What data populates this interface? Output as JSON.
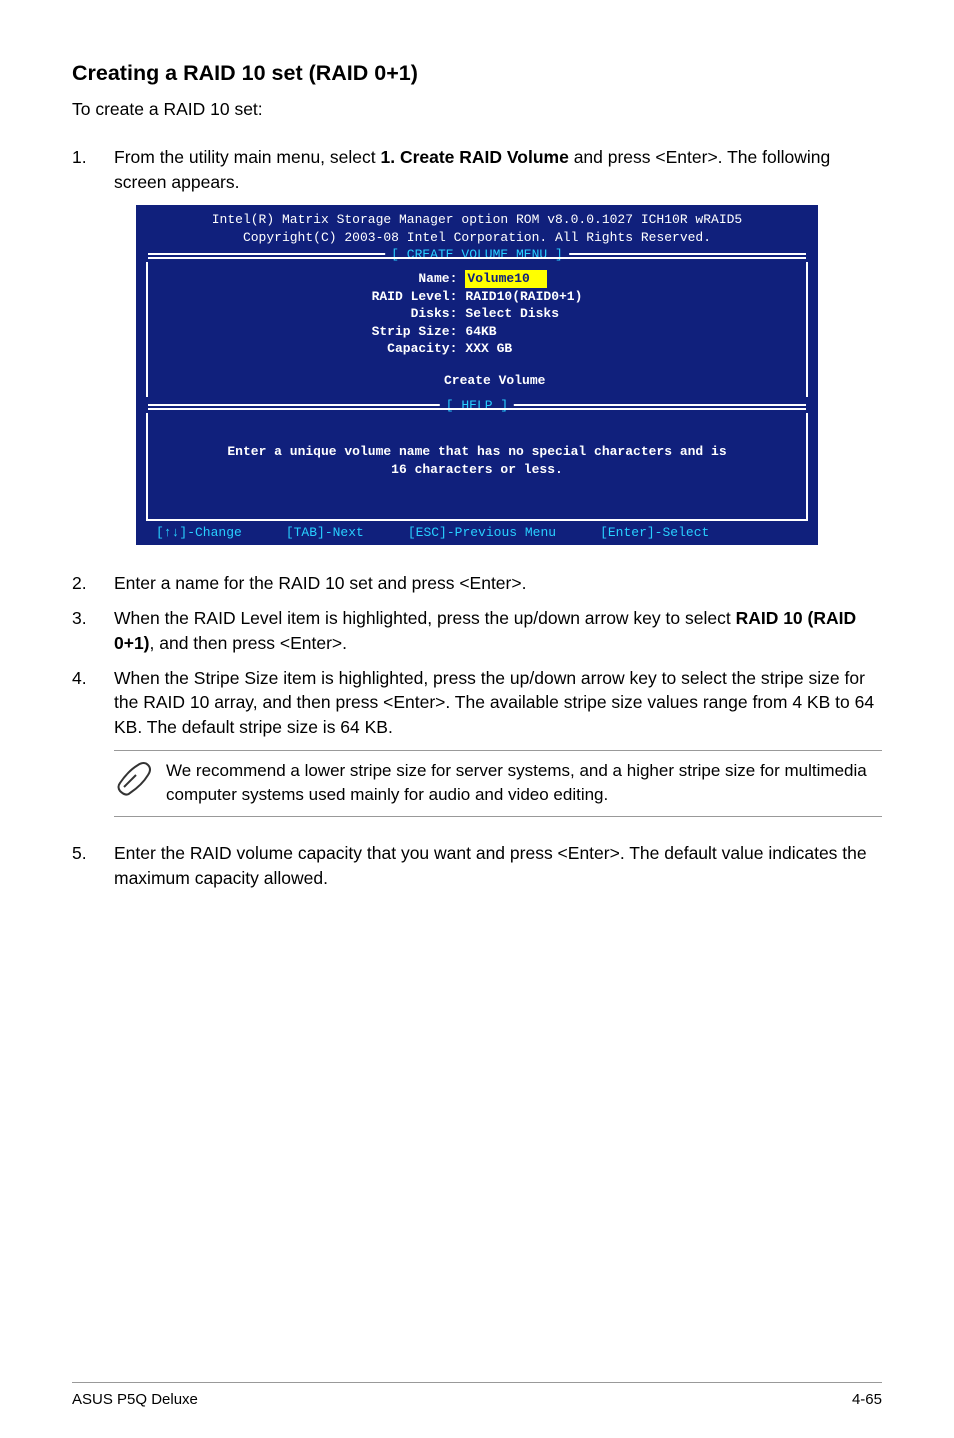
{
  "heading": "Creating a RAID 10 set (RAID 0+1)",
  "intro": "To create a RAID 10 set:",
  "step1_num": "1.",
  "step1_a": "From the utility main menu, select ",
  "step1_bold": "1. Create RAID Volume",
  "step1_b": " and press <Enter>. The following screen appears.",
  "bios": {
    "header1": "Intel(R) Matrix Storage Manager option ROM v8.0.0.1027 ICH10R wRAID5",
    "header2": "Copyright(C) 2003-08 Intel Corporation. All Rights Reserved.",
    "menu_title": "[ CREATE VOLUME MENU ]",
    "rows": {
      "name_lbl": "Name:",
      "name_val": "Volume10",
      "raid_lbl": "RAID Level:",
      "raid_val": "RAID10(RAID0+1)",
      "disks_lbl": "Disks:",
      "disks_val": "Select Disks",
      "strip_lbl": "Strip Size:",
      "strip_val": "64KB",
      "cap_lbl": "Capacity:",
      "cap_val": "XXX   GB"
    },
    "create": "Create Volume",
    "help_label": "[ HELP ]",
    "help_line1": "Enter a unique volume name that has no special characters and is",
    "help_line2": "16 characters or less.",
    "footer": {
      "k1": "[↑↓]-Change",
      "k2": "[TAB]-Next",
      "k3": "[ESC]-Previous Menu",
      "k4": "[Enter]-Select"
    }
  },
  "step2_num": "2.",
  "step2": "Enter a name for the RAID 10 set and press <Enter>.",
  "step3_num": "3.",
  "step3_a": "When the RAID Level item is highlighted, press the up/down arrow key to select ",
  "step3_bold": "RAID 10 (RAID 0+1)",
  "step3_b": ", and then press <Enter>.",
  "step4_num": "4.",
  "step4": "When the Stripe Size item is highlighted, press the up/down arrow key to select the stripe size for the RAID 10 array, and then press <Enter>. The available stripe size values range from 4 KB to 64 KB. The default stripe size is 64 KB.",
  "note_text": "We recommend a lower stripe size for server systems, and a higher stripe size for multimedia computer systems used mainly for audio and video editing.",
  "step5_num": "5.",
  "step5": "Enter the RAID volume capacity that you want and press <Enter>. The default value indicates the maximum capacity allowed.",
  "footer_left": "ASUS P5Q Deluxe",
  "footer_right": "4-65"
}
